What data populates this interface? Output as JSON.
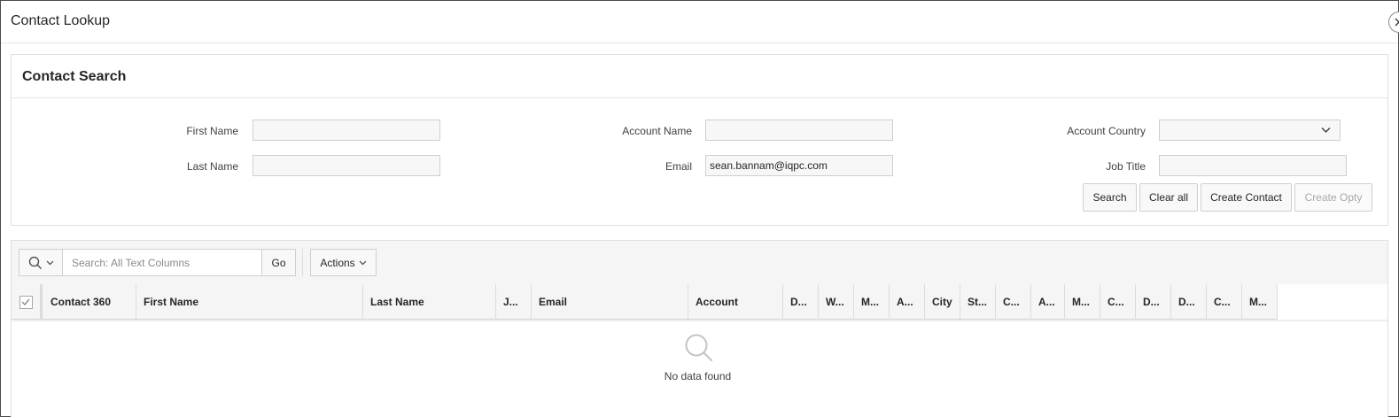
{
  "dialog": {
    "title": "Contact Lookup",
    "close_icon": "close-icon"
  },
  "search_region": {
    "title": "Contact Search",
    "fields": {
      "first_name": {
        "label": "First Name",
        "value": ""
      },
      "last_name": {
        "label": "Last Name",
        "value": ""
      },
      "account_name": {
        "label": "Account Name",
        "value": ""
      },
      "email": {
        "label": "Email",
        "value": "sean.bannam@iqpc.com"
      },
      "account_country": {
        "label": "Account Country",
        "value": ""
      },
      "job_title": {
        "label": "Job Title",
        "value": ""
      }
    },
    "buttons": {
      "search": "Search",
      "clear_all": "Clear all",
      "create_contact": "Create Contact",
      "create_opty": "Create Opty"
    }
  },
  "report": {
    "toolbar": {
      "search_placeholder": "Search: All Text Columns",
      "go_label": "Go",
      "actions_label": "Actions"
    },
    "columns": [
      "Contact 360",
      "First Name",
      "Last Name",
      "J...",
      "Email",
      "Account",
      "D...",
      "W...",
      "M...",
      "A...",
      "City",
      "St...",
      "C...",
      "A...",
      "M...",
      "C...",
      "D...",
      "D...",
      "C...",
      "M..."
    ],
    "empty_message": "No data found"
  },
  "colors": {
    "border": "#dfdfdf",
    "header_bg": "#f5f5f5",
    "disabled_text": "#a9a9a9"
  }
}
